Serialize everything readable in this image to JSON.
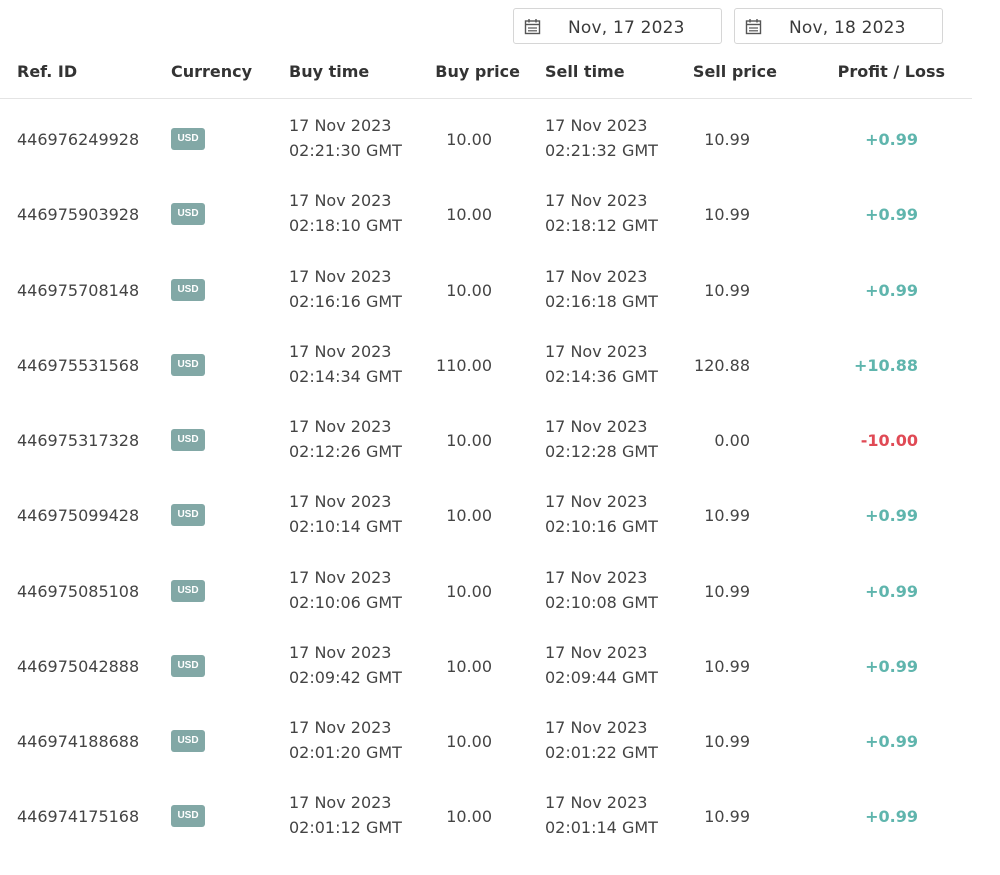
{
  "filters": {
    "date_from": "Nov, 17 2023",
    "date_to": "Nov, 18 2023"
  },
  "columns": {
    "ref_id": "Ref. ID",
    "currency": "Currency",
    "buy_time": "Buy time",
    "buy_price": "Buy price",
    "sell_time": "Sell time",
    "sell_price": "Sell price",
    "profit_loss": "Profit / Loss"
  },
  "colors": {
    "profit": "#5fb5ad",
    "loss": "#e04a55",
    "badge": "#82a8a6"
  },
  "rows": [
    {
      "ref": "446976249928",
      "currency": "USD",
      "buy_date": "17 Nov 2023",
      "buy_clock": "02:21:30 GMT",
      "buy_price": "10.00",
      "sell_date": "17 Nov 2023",
      "sell_clock": "02:21:32 GMT",
      "sell_price": "10.99",
      "pl": "+0.99",
      "pl_sign": "pos"
    },
    {
      "ref": "446975903928",
      "currency": "USD",
      "buy_date": "17 Nov 2023",
      "buy_clock": "02:18:10 GMT",
      "buy_price": "10.00",
      "sell_date": "17 Nov 2023",
      "sell_clock": "02:18:12 GMT",
      "sell_price": "10.99",
      "pl": "+0.99",
      "pl_sign": "pos"
    },
    {
      "ref": "446975708148",
      "currency": "USD",
      "buy_date": "17 Nov 2023",
      "buy_clock": "02:16:16 GMT",
      "buy_price": "10.00",
      "sell_date": "17 Nov 2023",
      "sell_clock": "02:16:18 GMT",
      "sell_price": "10.99",
      "pl": "+0.99",
      "pl_sign": "pos"
    },
    {
      "ref": "446975531568",
      "currency": "USD",
      "buy_date": "17 Nov 2023",
      "buy_clock": "02:14:34 GMT",
      "buy_price": "110.00",
      "sell_date": "17 Nov 2023",
      "sell_clock": "02:14:36 GMT",
      "sell_price": "120.88",
      "pl": "+10.88",
      "pl_sign": "pos"
    },
    {
      "ref": "446975317328",
      "currency": "USD",
      "buy_date": "17 Nov 2023",
      "buy_clock": "02:12:26 GMT",
      "buy_price": "10.00",
      "sell_date": "17 Nov 2023",
      "sell_clock": "02:12:28 GMT",
      "sell_price": "0.00",
      "pl": "-10.00",
      "pl_sign": "neg"
    },
    {
      "ref": "446975099428",
      "currency": "USD",
      "buy_date": "17 Nov 2023",
      "buy_clock": "02:10:14 GMT",
      "buy_price": "10.00",
      "sell_date": "17 Nov 2023",
      "sell_clock": "02:10:16 GMT",
      "sell_price": "10.99",
      "pl": "+0.99",
      "pl_sign": "pos"
    },
    {
      "ref": "446975085108",
      "currency": "USD",
      "buy_date": "17 Nov 2023",
      "buy_clock": "02:10:06 GMT",
      "buy_price": "10.00",
      "sell_date": "17 Nov 2023",
      "sell_clock": "02:10:08 GMT",
      "sell_price": "10.99",
      "pl": "+0.99",
      "pl_sign": "pos"
    },
    {
      "ref": "446975042888",
      "currency": "USD",
      "buy_date": "17 Nov 2023",
      "buy_clock": "02:09:42 GMT",
      "buy_price": "10.00",
      "sell_date": "17 Nov 2023",
      "sell_clock": "02:09:44 GMT",
      "sell_price": "10.99",
      "pl": "+0.99",
      "pl_sign": "pos"
    },
    {
      "ref": "446974188688",
      "currency": "USD",
      "buy_date": "17 Nov 2023",
      "buy_clock": "02:01:20 GMT",
      "buy_price": "10.00",
      "sell_date": "17 Nov 2023",
      "sell_clock": "02:01:22 GMT",
      "sell_price": "10.99",
      "pl": "+0.99",
      "pl_sign": "pos"
    },
    {
      "ref": "446974175168",
      "currency": "USD",
      "buy_date": "17 Nov 2023",
      "buy_clock": "02:01:12 GMT",
      "buy_price": "10.00",
      "sell_date": "17 Nov 2023",
      "sell_clock": "02:01:14 GMT",
      "sell_price": "10.99",
      "pl": "+0.99",
      "pl_sign": "pos"
    }
  ]
}
